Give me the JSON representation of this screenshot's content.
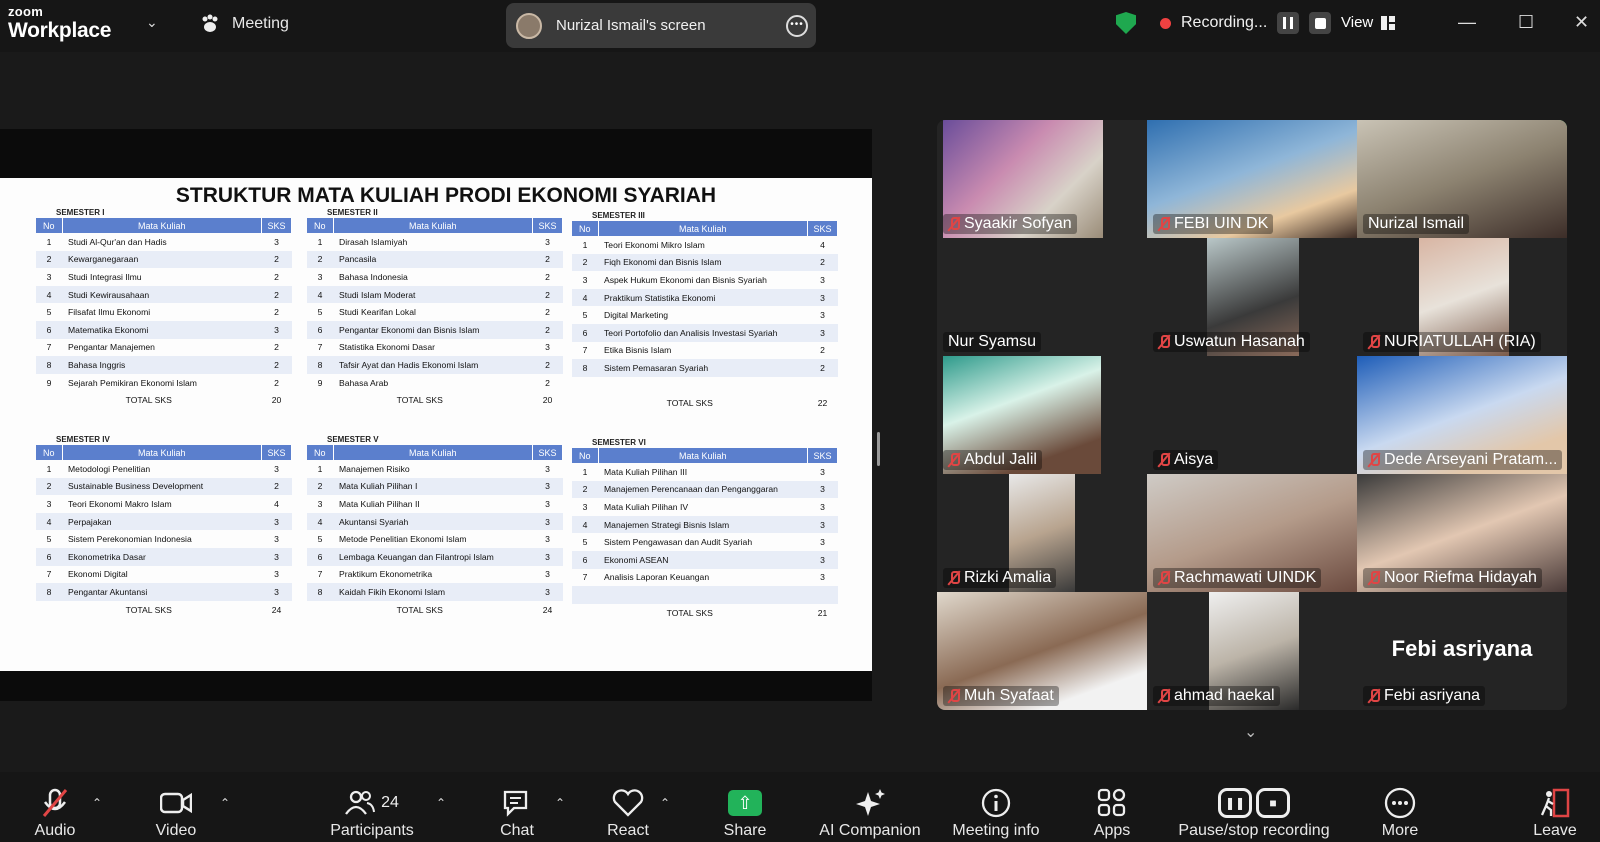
{
  "app": {
    "brand_line1": "zoom",
    "brand_line2": "Workplace",
    "meeting_label": "Meeting"
  },
  "screen_share": {
    "owner": "Nurizal Ismail's screen"
  },
  "recording": {
    "label": "Recording..."
  },
  "view": {
    "label": "View"
  },
  "slide": {
    "title": "STRUKTUR MATA KULIAH PRODI EKONOMI SYARIAH",
    "col_no": "No",
    "col_mk": "Mata Kuliah",
    "col_sks": "SKS",
    "total_label": "TOTAL SKS",
    "semesters": [
      {
        "name": "SEMESTER I",
        "total": "20",
        "rows": [
          [
            "1",
            "Studi Al-Qur'an dan Hadis",
            "3"
          ],
          [
            "2",
            "Kewarganegaraan",
            "2"
          ],
          [
            "3",
            "Studi Integrasi Ilmu",
            "2"
          ],
          [
            "4",
            "Studi Kewirausahaan",
            "2"
          ],
          [
            "5",
            "Filsafat Ilmu Ekonomi",
            "2"
          ],
          [
            "6",
            "Matematika Ekonomi",
            "3"
          ],
          [
            "7",
            "Pengantar Manajemen",
            "2"
          ],
          [
            "8",
            "Bahasa Inggris",
            "2"
          ],
          [
            "9",
            "Sejarah Pemikiran Ekonomi Islam",
            "2"
          ]
        ]
      },
      {
        "name": "SEMESTER II",
        "total": "20",
        "rows": [
          [
            "1",
            "Dirasah Islamiyah",
            "3"
          ],
          [
            "2",
            "Pancasila",
            "2"
          ],
          [
            "3",
            "Bahasa Indonesia",
            "2"
          ],
          [
            "4",
            "Studi Islam Moderat",
            "2"
          ],
          [
            "5",
            "Studi Kearifan Lokal",
            "2"
          ],
          [
            "6",
            "Pengantar Ekonomi dan Bisnis Islam",
            "2"
          ],
          [
            "7",
            "Statistika Ekonomi Dasar",
            "3"
          ],
          [
            "8",
            "Tafsir Ayat dan Hadis Ekonomi Islam",
            "2"
          ],
          [
            "9",
            "Bahasa Arab",
            "2"
          ]
        ]
      },
      {
        "name": "SEMESTER III",
        "total": "22",
        "rows": [
          [
            "1",
            "Teori Ekonomi Mikro Islam",
            "4"
          ],
          [
            "2",
            "Fiqh Ekonomi dan Bisnis Islam",
            "2"
          ],
          [
            "3",
            "Aspek Hukum Ekonomi dan Bisnis Syariah",
            "3"
          ],
          [
            "4",
            "Praktikum Statistika Ekonomi",
            "3"
          ],
          [
            "5",
            "Digital Marketing",
            "3"
          ],
          [
            "6",
            "Teori Portofolio dan Analisis Investasi Syariah",
            "3"
          ],
          [
            "7",
            "Etika Bisnis Islam",
            "2"
          ],
          [
            "8",
            "Sistem Pemasaran Syariah",
            "2"
          ],
          [
            "",
            "",
            ""
          ]
        ]
      },
      {
        "name": "SEMESTER IV",
        "total": "24",
        "rows": [
          [
            "1",
            "Metodologi Penelitian",
            "3"
          ],
          [
            "2",
            "Sustainable Business Development",
            "2"
          ],
          [
            "3",
            "Teori Ekonomi Makro Islam",
            "4"
          ],
          [
            "4",
            "Perpajakan",
            "3"
          ],
          [
            "5",
            "Sistem Perekonomian Indonesia",
            "3"
          ],
          [
            "6",
            "Ekonometrika Dasar",
            "3"
          ],
          [
            "7",
            "Ekonomi Digital",
            "3"
          ],
          [
            "8",
            "Pengantar Akuntansi",
            "3"
          ]
        ]
      },
      {
        "name": "SEMESTER V",
        "total": "24",
        "rows": [
          [
            "1",
            "Manajemen Risiko",
            "3"
          ],
          [
            "2",
            "Mata Kuliah Pilihan I",
            "3"
          ],
          [
            "3",
            "Mata Kuliah Pilihan II",
            "3"
          ],
          [
            "4",
            "Akuntansi Syariah",
            "3"
          ],
          [
            "5",
            "Metode Penelitian Ekonomi Islam",
            "3"
          ],
          [
            "6",
            "Lembaga Keuangan dan Filantropi Islam",
            "3"
          ],
          [
            "7",
            "Praktikum Ekonometrika",
            "3"
          ],
          [
            "8",
            "Kaidah Fikih Ekonomi Islam",
            "3"
          ]
        ]
      },
      {
        "name": "SEMESTER VI",
        "total": "21",
        "rows": [
          [
            "1",
            "Mata Kuliah Pilihan III",
            "3"
          ],
          [
            "2",
            "Manajemen Perencanaan dan Penganggaran",
            "3"
          ],
          [
            "3",
            "Mata Kuliah Pilihan IV",
            "3"
          ],
          [
            "4",
            "Manajemen Strategi Bisnis Islam",
            "3"
          ],
          [
            "5",
            "Sistem Pengawasan dan Audit Syariah",
            "3"
          ],
          [
            "6",
            "Ekonomi ASEAN",
            "3"
          ],
          [
            "7",
            "Analisis Laporan Keuangan",
            "3"
          ],
          [
            "",
            "",
            " "
          ]
        ]
      }
    ]
  },
  "participants": [
    {
      "name": "Syaakir Sofyan",
      "muted": true
    },
    {
      "name": "FEBI UIN DK",
      "muted": true
    },
    {
      "name": "Nurizal Ismail",
      "muted": false
    },
    {
      "name": "Nur Syamsu",
      "muted": false
    },
    {
      "name": "Uswatun Hasanah",
      "muted": true
    },
    {
      "name": "NURIATULLAH (RIA)",
      "muted": true
    },
    {
      "name": "Abdul Jalil",
      "muted": true
    },
    {
      "name": "Aisya",
      "muted": true
    },
    {
      "name": "Dede Arseyani Pratam...",
      "muted": true
    },
    {
      "name": "Rizki Amalia",
      "muted": true
    },
    {
      "name": "Rachmawati UINDK",
      "muted": true
    },
    {
      "name": "Noor Riefma Hidayah",
      "muted": true
    },
    {
      "name": "Muh Syafaat",
      "muted": true
    },
    {
      "name": "ahmad haekal",
      "muted": true
    },
    {
      "name": "Febi asriyana",
      "muted": true,
      "display_name": "Febi asriyana"
    }
  ],
  "toolbar": {
    "audio": "Audio",
    "video": "Video",
    "participants": "Participants",
    "participants_count": "24",
    "chat": "Chat",
    "react": "React",
    "share": "Share",
    "ai": "AI Companion",
    "info": "Meeting info",
    "apps": "Apps",
    "pause_rec": "Pause/stop recording",
    "more": "More",
    "leave": "Leave"
  },
  "colors": {
    "accent_green": "#22b35a",
    "active_speaker": "#4fd67f",
    "muted_red": "#e04545",
    "table_header": "#5b7fcd"
  }
}
